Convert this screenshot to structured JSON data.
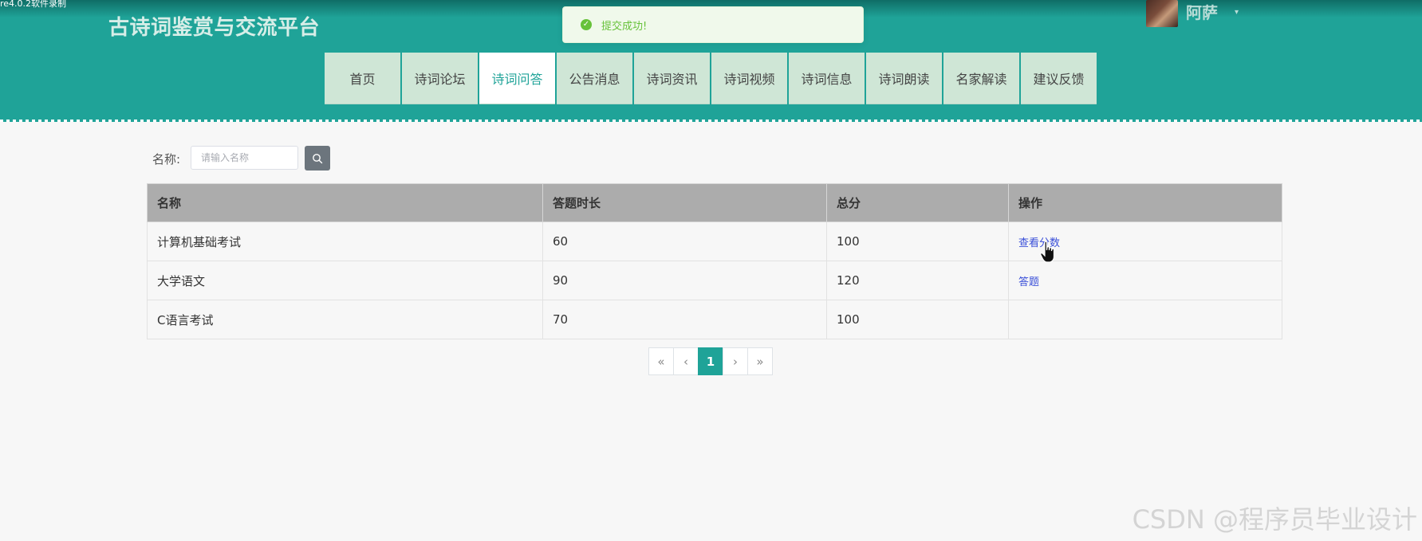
{
  "recorder_mark": "re4.0.2软件录制",
  "header": {
    "title": "古诗词鉴赏与交流平台",
    "user": {
      "name": "阿萨",
      "caret": "▾"
    }
  },
  "toast": {
    "message": "提交成功!"
  },
  "nav": {
    "active_index": 2,
    "items": [
      {
        "label": "首页"
      },
      {
        "label": "诗词论坛"
      },
      {
        "label": "诗词问答"
      },
      {
        "label": "公告消息"
      },
      {
        "label": "诗词资讯"
      },
      {
        "label": "诗词视频"
      },
      {
        "label": "诗词信息"
      },
      {
        "label": "诗词朗读"
      },
      {
        "label": "名家解读"
      },
      {
        "label": "建议反馈"
      }
    ]
  },
  "search": {
    "label": "名称:",
    "placeholder": "请输入名称",
    "value": ""
  },
  "table": {
    "headers": [
      "名称",
      "答题时长",
      "总分",
      "操作"
    ],
    "rows": [
      {
        "name": "计算机基础考试",
        "duration": "60",
        "score": "100",
        "action": "查看分数"
      },
      {
        "name": "大学语文",
        "duration": "90",
        "score": "120",
        "action": "答题"
      },
      {
        "name": "C语言考试",
        "duration": "70",
        "score": "100",
        "action": ""
      }
    ]
  },
  "pagination": {
    "first": "«",
    "prev": "‹",
    "current": "1",
    "next": "›",
    "last": "»"
  },
  "watermark": "CSDN @程序员毕业设计",
  "colors": {
    "header_teal": "#1fa398",
    "nav_bg": "#cfe6d6",
    "table_header": "#acacac",
    "link_blue": "#3a4fd8",
    "success_green": "#67c23a"
  },
  "icons": {
    "toast": "check-circle-icon",
    "search": "search-icon",
    "cursor": "hand-pointer-icon"
  }
}
